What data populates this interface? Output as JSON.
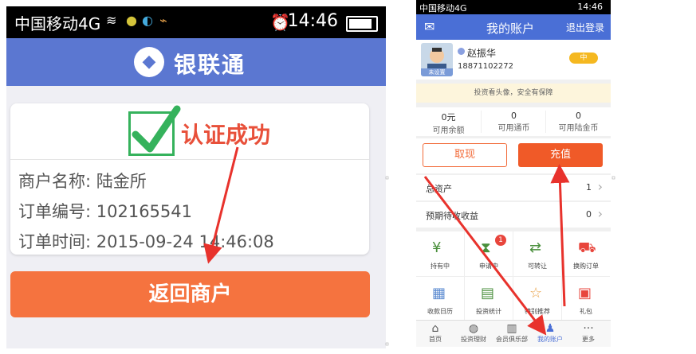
{
  "left": {
    "status": {
      "carrier": "中国移动4G",
      "time": "14:46"
    },
    "header": {
      "title": "银联通"
    },
    "result": {
      "title": "认证成功"
    },
    "info": [
      {
        "label": "商户名称: 陆金所"
      },
      {
        "label": "订单编号: 102165541"
      },
      {
        "label": "订单时间: 2015-09-24 14:46:08"
      }
    ],
    "button": "返回商户"
  },
  "right": {
    "status": {
      "carrier": "中国移动4G",
      "time": "14:46"
    },
    "header": {
      "title": "我的账户",
      "logout": "退出登录"
    },
    "profile": {
      "name": "赵振华",
      "phone": "18871102272",
      "avatar_tag": "未设置",
      "level": "中"
    },
    "tip": "投资看头像，安全有保障",
    "stats": [
      {
        "value": "0元",
        "label": "可用余额"
      },
      {
        "value": "0",
        "label": "可用通币"
      },
      {
        "value": "0",
        "label": "可用陆金币"
      }
    ],
    "actions": {
      "withdraw": "取现",
      "recharge": "充值"
    },
    "rows": [
      {
        "label": "总资产",
        "value": "1"
      },
      {
        "label": "预期待收收益",
        "value": "0"
      }
    ],
    "grid": [
      {
        "label": "持有中",
        "icon": "coins-icon"
      },
      {
        "label": "申请中",
        "icon": "hourglass-icon",
        "badge": "1"
      },
      {
        "label": "可转让",
        "icon": "transfer-icon"
      },
      {
        "label": "换购订单",
        "icon": "cart-icon"
      },
      {
        "label": "收款日历",
        "icon": "calendar-icon"
      },
      {
        "label": "投资统计",
        "icon": "doc-icon"
      },
      {
        "label": "特别推荐",
        "icon": "bag-icon"
      },
      {
        "label": "礼包",
        "icon": "gift-icon"
      }
    ],
    "tabs": [
      {
        "label": "首页",
        "icon": "home-icon"
      },
      {
        "label": "投资理财",
        "icon": "money-bag-icon"
      },
      {
        "label": "会员俱乐部",
        "icon": "club-icon"
      },
      {
        "label": "我的账户",
        "icon": "user-icon",
        "active": true
      },
      {
        "label": "更多",
        "icon": "more-icon"
      }
    ]
  },
  "colors": {
    "left_header": "#5b77d1",
    "right_header": "#4a6fd6",
    "orange": "#f5733f",
    "arrow": "#e8322c",
    "success_green": "#35b25c"
  }
}
